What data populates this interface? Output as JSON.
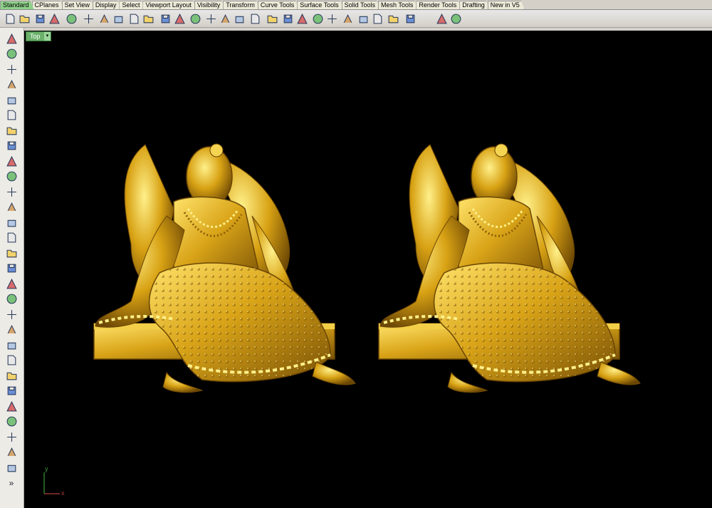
{
  "tabs": [
    "Standard",
    "CPlanes",
    "Set View",
    "Display",
    "Select",
    "Viewport Layout",
    "Visibility",
    "Transform",
    "Curve Tools",
    "Surface Tools",
    "Solid Tools",
    "Mesh Tools",
    "Render Tools",
    "Drafting",
    "New in V5"
  ],
  "active_tab": "Standard",
  "toolbar_icons": [
    "new-file-icon",
    "open-file-icon",
    "save-icon",
    "print-icon",
    "import-icon",
    "cut-icon",
    "copy-icon",
    "paste-icon",
    "undo-icon",
    "pan-hand-icon",
    "rotate-view-icon",
    "zoom-icon",
    "zoom-window-icon",
    "zoom-selected-icon",
    "undo-view-icon",
    "four-viewports-icon",
    "grid-snap-icon",
    "show-objects-icon",
    "point-icon",
    "hide-objects-icon",
    "bulb-icon",
    "lock-icon",
    "layer-icon",
    "color-wheel-icon",
    "material-ball-icon",
    "render-icon",
    "render-preview-icon",
    "options-icon",
    "help-icon"
  ],
  "left_icons": [
    "select-arrow-icon",
    "point-icon",
    "polyline-icon",
    "curve-point-icon",
    "circle-icon",
    "ellipse-icon",
    "arc-icon",
    "rectangle-icon",
    "polygon-icon",
    "fillet-curve-icon",
    "extrude-surface-icon",
    "loft-icon",
    "solid-box-icon",
    "solid-sphere-icon",
    "cylinder-icon",
    "boolean-icon",
    "mesh-icon",
    "explode-icon",
    "trim-icon",
    "split-icon",
    "join-icon",
    "group-icon",
    "transform-icon",
    "mirror-icon",
    "dimension-icon",
    "text-icon",
    "array-icon",
    "analyze-icon",
    "block-icon",
    "more-tools-icon"
  ],
  "viewport": {
    "name": "Top",
    "dropdown": "▾"
  },
  "axis": {
    "x": "x",
    "y": "y"
  },
  "colors": {
    "active_tab": "#8fd18a",
    "viewport_bg": "#000000",
    "gold": "#d4a419",
    "viewport_tab": "#6ab06a"
  }
}
